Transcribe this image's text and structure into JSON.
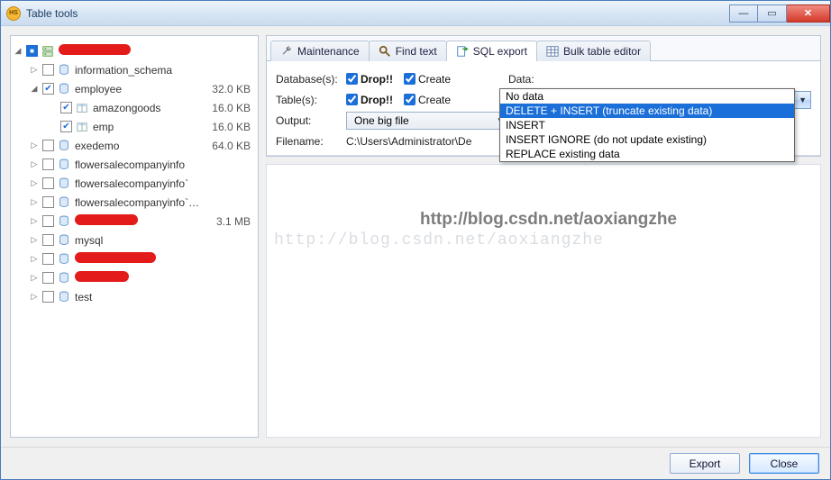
{
  "window": {
    "title": "Table tools"
  },
  "winbtns": {
    "min": "—",
    "max": "▭",
    "close": "✕"
  },
  "tree": {
    "root_redacted": true,
    "items": [
      {
        "type": "db",
        "depth": 1,
        "expander": "▷",
        "checked": false,
        "label": "information_schema",
        "size": ""
      },
      {
        "type": "db",
        "depth": 1,
        "expander": "◢",
        "checked": true,
        "label": "employee",
        "size": "32.0 KB"
      },
      {
        "type": "tb",
        "depth": 2,
        "expander": "",
        "checked": true,
        "label": "amazongoods",
        "size": "16.0 KB"
      },
      {
        "type": "tb",
        "depth": 2,
        "expander": "",
        "checked": true,
        "label": "emp",
        "size": "16.0 KB"
      },
      {
        "type": "db",
        "depth": 1,
        "expander": "▷",
        "checked": false,
        "label": "exedemo",
        "size": "64.0 KB"
      },
      {
        "type": "db",
        "depth": 1,
        "expander": "▷",
        "checked": false,
        "label": "flowersalecompanyinfo",
        "size": ""
      },
      {
        "type": "db",
        "depth": 1,
        "expander": "▷",
        "checked": false,
        "label": "flowersalecompanyinfo`",
        "size": ""
      },
      {
        "type": "db",
        "depth": 1,
        "expander": "▷",
        "checked": false,
        "label": "flowersalecompanyinfo`fl...",
        "size": ""
      },
      {
        "type": "db",
        "depth": 1,
        "expander": "▷",
        "checked": false,
        "redact": 70,
        "label": "",
        "size": "3.1 MB"
      },
      {
        "type": "db",
        "depth": 1,
        "expander": "▷",
        "checked": false,
        "label": "mysql",
        "size": ""
      },
      {
        "type": "db",
        "depth": 1,
        "expander": "▷",
        "checked": false,
        "redact": 90,
        "label": "",
        "size": ""
      },
      {
        "type": "db",
        "depth": 1,
        "expander": "▷",
        "checked": false,
        "redact": 60,
        "label": "",
        "size": ""
      },
      {
        "type": "db",
        "depth": 1,
        "expander": "▷",
        "checked": false,
        "label": "test",
        "size": ""
      }
    ]
  },
  "tabs": [
    {
      "id": "maintenance",
      "label": "Maintenance",
      "icon": "wrench"
    },
    {
      "id": "findtext",
      "label": "Find text",
      "icon": "search"
    },
    {
      "id": "sqlexport",
      "label": "SQL export",
      "icon": "export",
      "active": true
    },
    {
      "id": "bulkeditor",
      "label": "Bulk table editor",
      "icon": "table"
    }
  ],
  "form": {
    "row_db_label": "Database(s):",
    "row_tb_label": "Table(s):",
    "row_out_label": "Output:",
    "row_fn_label": "Filename:",
    "drop_label": "Drop!!",
    "create_label": "Create",
    "data_label": "Data:",
    "db_drop_checked": true,
    "db_create_checked": true,
    "tb_drop_checked": true,
    "tb_create_checked": true,
    "data_select_value": "REPLACE existing data",
    "data_options": [
      "No data",
      "DELETE + INSERT (truncate existing data)",
      "INSERT",
      "INSERT IGNORE (do not update existing)",
      "REPLACE existing data"
    ],
    "data_highlight_index": 1,
    "output_value": "One big file",
    "filename_value": "C:\\Users\\Administrator\\De"
  },
  "watermark": {
    "bold": "http://blog.csdn.net/aoxiangzhe",
    "light": "http://blog.csdn.net/aoxiangzhe"
  },
  "footer": {
    "export": "Export",
    "close": "Close"
  }
}
